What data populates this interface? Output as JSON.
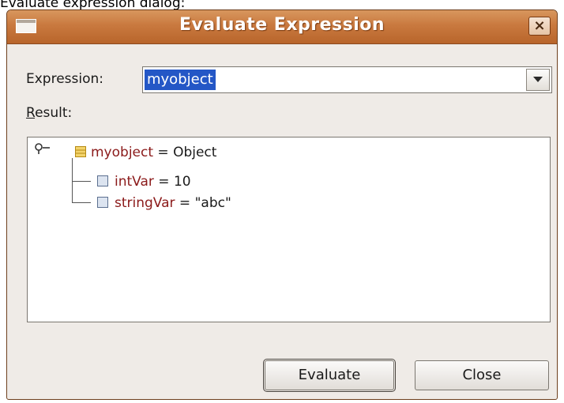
{
  "caption": "Evaluate expression dialog:",
  "window": {
    "title": "Evaluate Expression",
    "close_label": "×"
  },
  "expression": {
    "label": "Expression:",
    "value": "myobject"
  },
  "result": {
    "label_mnemonic": "R",
    "label_rest": "esult:"
  },
  "tree": {
    "root": {
      "name": "myobject",
      "value": " = Object"
    },
    "children": [
      {
        "name": "intVar",
        "value": " = 10"
      },
      {
        "name": "stringVar",
        "value": " = \"abc\""
      }
    ]
  },
  "buttons": {
    "evaluate": "Evaluate",
    "close": "Close"
  },
  "icons": {
    "window_menu": "window-menu-icon",
    "close": "close-icon",
    "dropdown": "chevron-down-icon",
    "object": "object-icon",
    "primitive": "primitive-field-icon",
    "watch": "watch-handle-icon"
  }
}
